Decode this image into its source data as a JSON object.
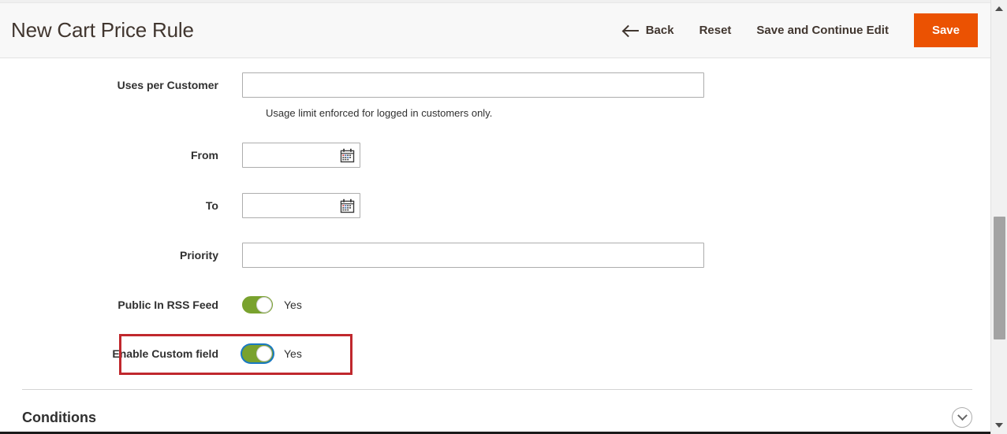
{
  "header": {
    "title": "New Cart Price Rule",
    "actions": {
      "back_label": "Back",
      "reset_label": "Reset",
      "save_continue_label": "Save and Continue Edit",
      "save_label": "Save"
    },
    "accent_color": "#eb5202",
    "background_color": "#f8f8f8"
  },
  "form": {
    "uses_per_customer": {
      "label": "Uses per Customer",
      "value": "",
      "placeholder": "",
      "note": "Usage limit enforced for logged in customers only."
    },
    "from": {
      "label": "From",
      "value": "",
      "placeholder": "",
      "calendar_icon": "calendar-icon"
    },
    "to": {
      "label": "To",
      "value": "",
      "placeholder": "",
      "calendar_icon": "calendar-icon"
    },
    "priority": {
      "label": "Priority",
      "value": "",
      "placeholder": ""
    },
    "public_in_rss_feed": {
      "label": "Public In RSS Feed",
      "state_text": "Yes",
      "enabled": true,
      "on_color": "#79a22e"
    },
    "enable_custom_field": {
      "label": "Enable Custom field",
      "state_text": "Yes",
      "enabled": true,
      "focused": true,
      "on_color": "#79a22e",
      "focus_color": "#1979c3",
      "highlight_color": "#c0282d"
    }
  },
  "sections": {
    "conditions": {
      "title": "Conditions",
      "expanded": false,
      "toggle_icon": "chevron-down-icon"
    }
  },
  "scrollbar": {
    "up_icon": "scroll-up-arrow-icon",
    "down_icon": "scroll-down-arrow-icon"
  }
}
